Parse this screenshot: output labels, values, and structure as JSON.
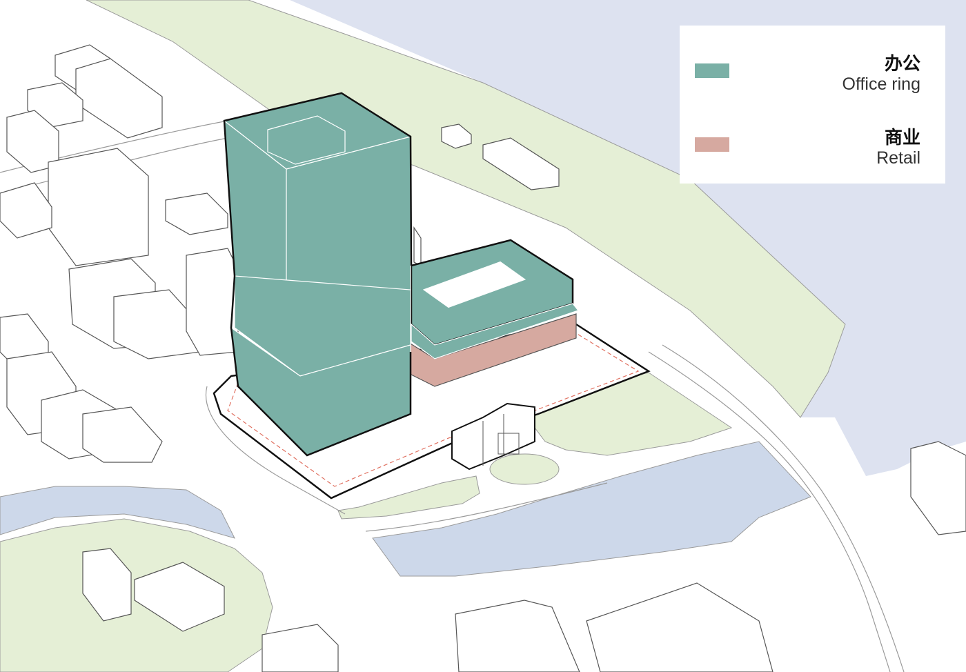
{
  "colors": {
    "background": "#ffffff",
    "water": "#dde2f0",
    "canal": "#cdd8ea",
    "park": "#e5efd6",
    "office": "#7ab0a6",
    "retail": "#d6a9a0",
    "building_outline": "#555555",
    "site_boundary": "#e07060"
  },
  "legend": {
    "items": [
      {
        "label_cn": "办公",
        "label_en": "Office ring",
        "color": "#7ab0a6"
      },
      {
        "label_cn": "商业",
        "label_en": "Retail",
        "color": "#d6a9a0"
      }
    ]
  }
}
